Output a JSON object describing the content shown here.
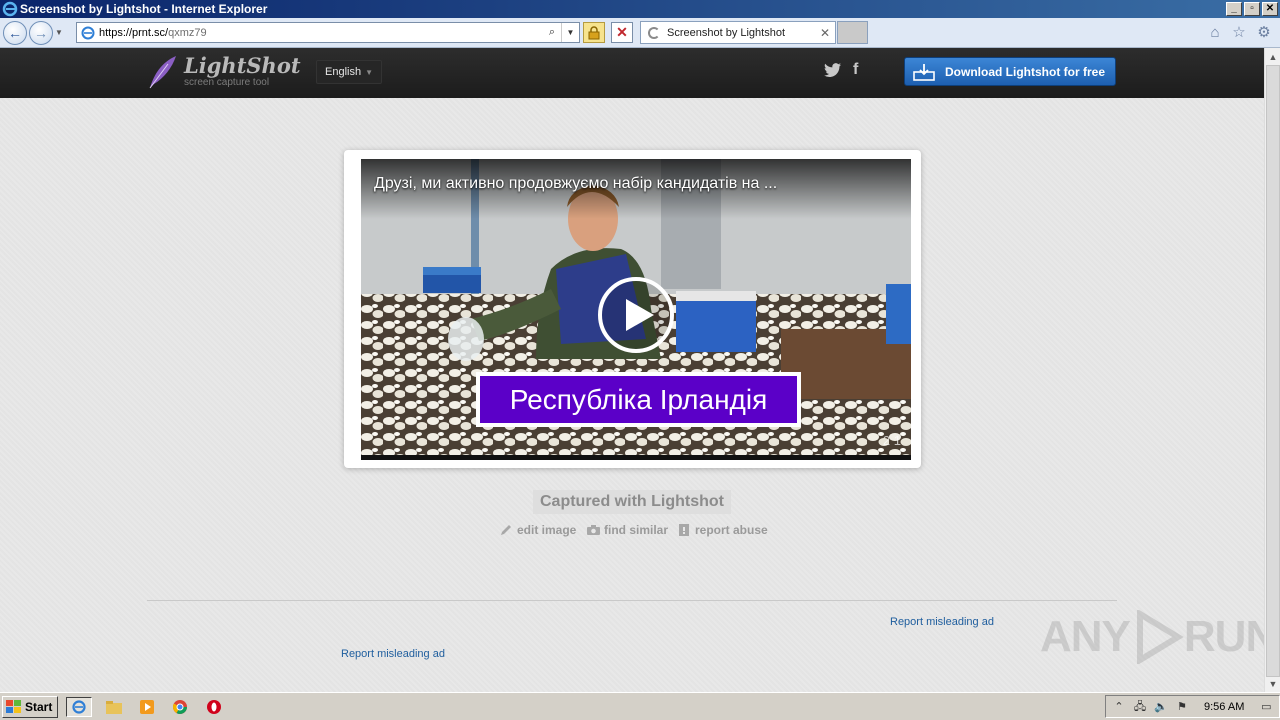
{
  "window": {
    "title": "Screenshot by Lightshot - Internet Explorer",
    "buttons": {
      "minimize": "_",
      "maximize": "▫",
      "close": "✕"
    }
  },
  "address_bar": {
    "url_host": "https://prnt.sc/",
    "url_path": "qxmz79"
  },
  "tab": {
    "label": "Screenshot by Lightshot",
    "close": "✕"
  },
  "site_header": {
    "logo_name": "LightShot",
    "logo_tagline": "screen capture tool",
    "language": "English",
    "social": {
      "twitter": "🐦",
      "facebook": "f"
    },
    "download_label": "Download Lightshot for free"
  },
  "screenshot": {
    "video_title": "Друзі, ми активно продовжуємо набір кандидатів на ...",
    "caption": "Республіка Ірландія",
    "stats": "2     1"
  },
  "captured_label": "Captured with Lightshot",
  "actions": {
    "edit": "edit image",
    "find_similar": "find similar",
    "report": "report abuse"
  },
  "ads": {
    "report_right": "Report misleading ad",
    "report_left": "Report misleading ad"
  },
  "watermark": {
    "left": "ANY",
    "right": "RUN"
  },
  "taskbar": {
    "start": "Start",
    "clock": "9:56 AM"
  },
  "colors": {
    "accent_blue": "#1d5fb0",
    "caption_purple": "#5b00c8",
    "link_blue": "#1f5e9e"
  }
}
